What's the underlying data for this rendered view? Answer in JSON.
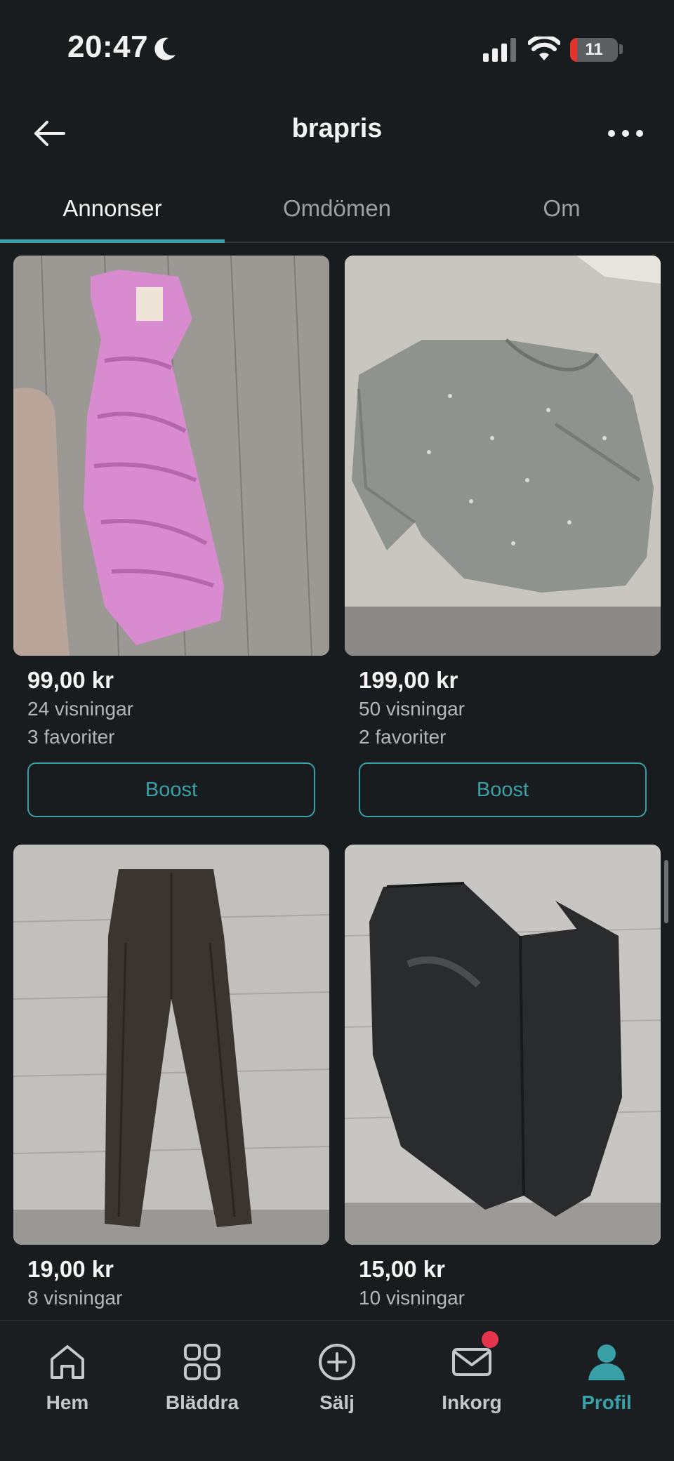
{
  "status_bar": {
    "time": "20:47",
    "battery_level": "11",
    "icons": [
      "moon-icon",
      "cellular-signal-icon",
      "wifi-icon",
      "battery-icon"
    ]
  },
  "header": {
    "title": "brapris",
    "back_icon": "arrow-left-icon",
    "more_icon": "more-horizontal-icon"
  },
  "tabs": [
    {
      "label": "Annonser",
      "active": true
    },
    {
      "label": "Omdömen",
      "active": false
    },
    {
      "label": "Om",
      "active": false
    }
  ],
  "listings": [
    {
      "image": "pink satin dress photo",
      "price": "99,00 kr",
      "views": "24 visningar",
      "favorites": "3 favoriter",
      "boost_label": "Boost"
    },
    {
      "image": "grey sequin top photo",
      "price": "199,00 kr",
      "views": "50 visningar",
      "favorites": "2 favoriter",
      "boost_label": "Boost"
    },
    {
      "image": "dark brown leather trousers photo",
      "price": "19,00 kr",
      "views": "8 visningar"
    },
    {
      "image": "black leather leggings photo",
      "price": "15,00 kr",
      "views": "10 visningar"
    }
  ],
  "bottom_nav": [
    {
      "label": "Hem",
      "icon": "home-icon",
      "active": false
    },
    {
      "label": "Bläddra",
      "icon": "grid-icon",
      "active": false
    },
    {
      "label": "Sälj",
      "icon": "plus-circle-icon",
      "active": false
    },
    {
      "label": "Inkorg",
      "icon": "mail-icon",
      "active": false,
      "has_badge": true
    },
    {
      "label": "Profil",
      "icon": "person-icon",
      "active": true
    }
  ],
  "colors": {
    "background": "#191c1e",
    "accent": "#3aa0a8",
    "badge": "#e5344c",
    "battery_low": "#e5342c"
  }
}
